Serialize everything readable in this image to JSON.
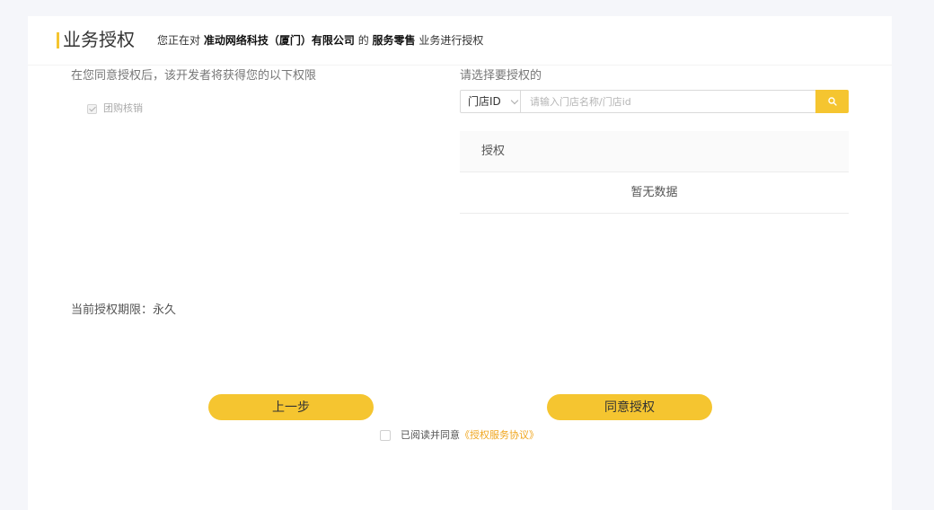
{
  "header": {
    "title": "业务授权",
    "subtitle_prefix": "您正在对",
    "company": "准动网络科技（厦门）有限公司",
    "of": "的",
    "service": "服务零售",
    "subtitle_suffix": "业务进行授权"
  },
  "permissions": {
    "heading": "在您同意授权后，该开发者将获得您的以下权限",
    "items": [
      {
        "label": "团购核销",
        "checked": true
      }
    ]
  },
  "selection": {
    "heading": "请选择要授权的",
    "store_select": {
      "value": "门店ID"
    },
    "search": {
      "placeholder": "请输入门店名称/门店id"
    },
    "table": {
      "column": "授权",
      "empty_text": "暂无数据"
    }
  },
  "period": {
    "text": "当前授权期限：永久"
  },
  "actions": {
    "prev_label": "上一步",
    "agree_label": "同意授权"
  },
  "agreement": {
    "text": "已阅读并同意",
    "link": "《授权服务协议》",
    "checked": false
  },
  "colors": {
    "accent": "#f5c530",
    "link": "#f0a61e",
    "background": "#f5f6fa"
  }
}
